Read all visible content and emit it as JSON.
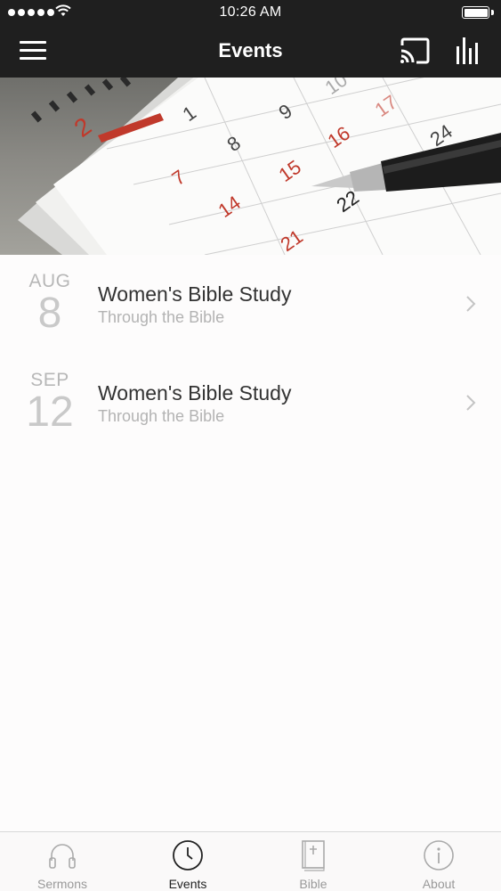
{
  "status_bar": {
    "time": "10:26 AM"
  },
  "nav": {
    "title": "Events",
    "left_icon": "hamburger-menu-icon",
    "right_icons": [
      "cast-icon",
      "bar-chart-icon"
    ]
  },
  "hero": {
    "description_icon": "calendar-photo",
    "calendar_numbers": [
      "2",
      "1",
      "9",
      "10",
      "17",
      "8",
      "16",
      "24",
      "7",
      "15",
      "14",
      "22",
      "21"
    ]
  },
  "events": [
    {
      "month": "AUG",
      "day": "8",
      "title": "Women's Bible Study",
      "subtitle": "Through the Bible"
    },
    {
      "month": "SEP",
      "day": "12",
      "title": "Women's Bible Study",
      "subtitle": "Through the Bible"
    }
  ],
  "tabs": [
    {
      "label": "Sermons",
      "icon": "headphones-icon",
      "active": false
    },
    {
      "label": "Events",
      "icon": "clock-icon",
      "active": true
    },
    {
      "label": "Bible",
      "icon": "bible-icon",
      "active": false
    },
    {
      "label": "About",
      "icon": "info-icon",
      "active": false
    }
  ],
  "colors": {
    "header_bg": "#1f1f1f",
    "page_bg": "#fdfcfc",
    "accent_red": "#c0392b"
  }
}
